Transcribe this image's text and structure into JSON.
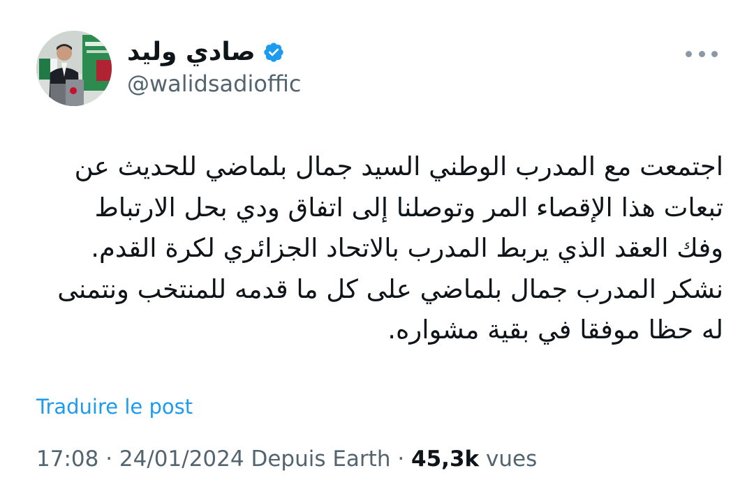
{
  "author": {
    "display_name": "صادي وليد",
    "handle": "@walidsadioffic",
    "verified": true,
    "avatar_icon": "profile-photo"
  },
  "tweet": {
    "text_lines": [
      "اجتمعت مع المدرب الوطني السيد جمال بلماضي للحديث عن",
      "تبعات هذا الإقصاء المر وتوصلنا إلى اتفاق ودي بحل الارتباط",
      "وفك العقد الذي يربط المدرب بالاتحاد الجزائري لكرة القدم.",
      "نشكر المدرب جمال بلماضي على كل ما قدمه للمنتخب ونتمنى",
      "له حظا موفقا في بقية مشواره."
    ],
    "translate_label": "Traduire le post"
  },
  "meta": {
    "time": "17:08",
    "separator": " · ",
    "date": "24/01/2024",
    "source": "Depuis Earth",
    "views_count": "45,3k",
    "views_label": "vues"
  },
  "icons": {
    "verified": "verified-badge-icon",
    "more": "more-options-icon"
  },
  "colors": {
    "accent": "#1d9bf0",
    "text_primary": "#0f1419",
    "text_secondary": "#536471"
  }
}
